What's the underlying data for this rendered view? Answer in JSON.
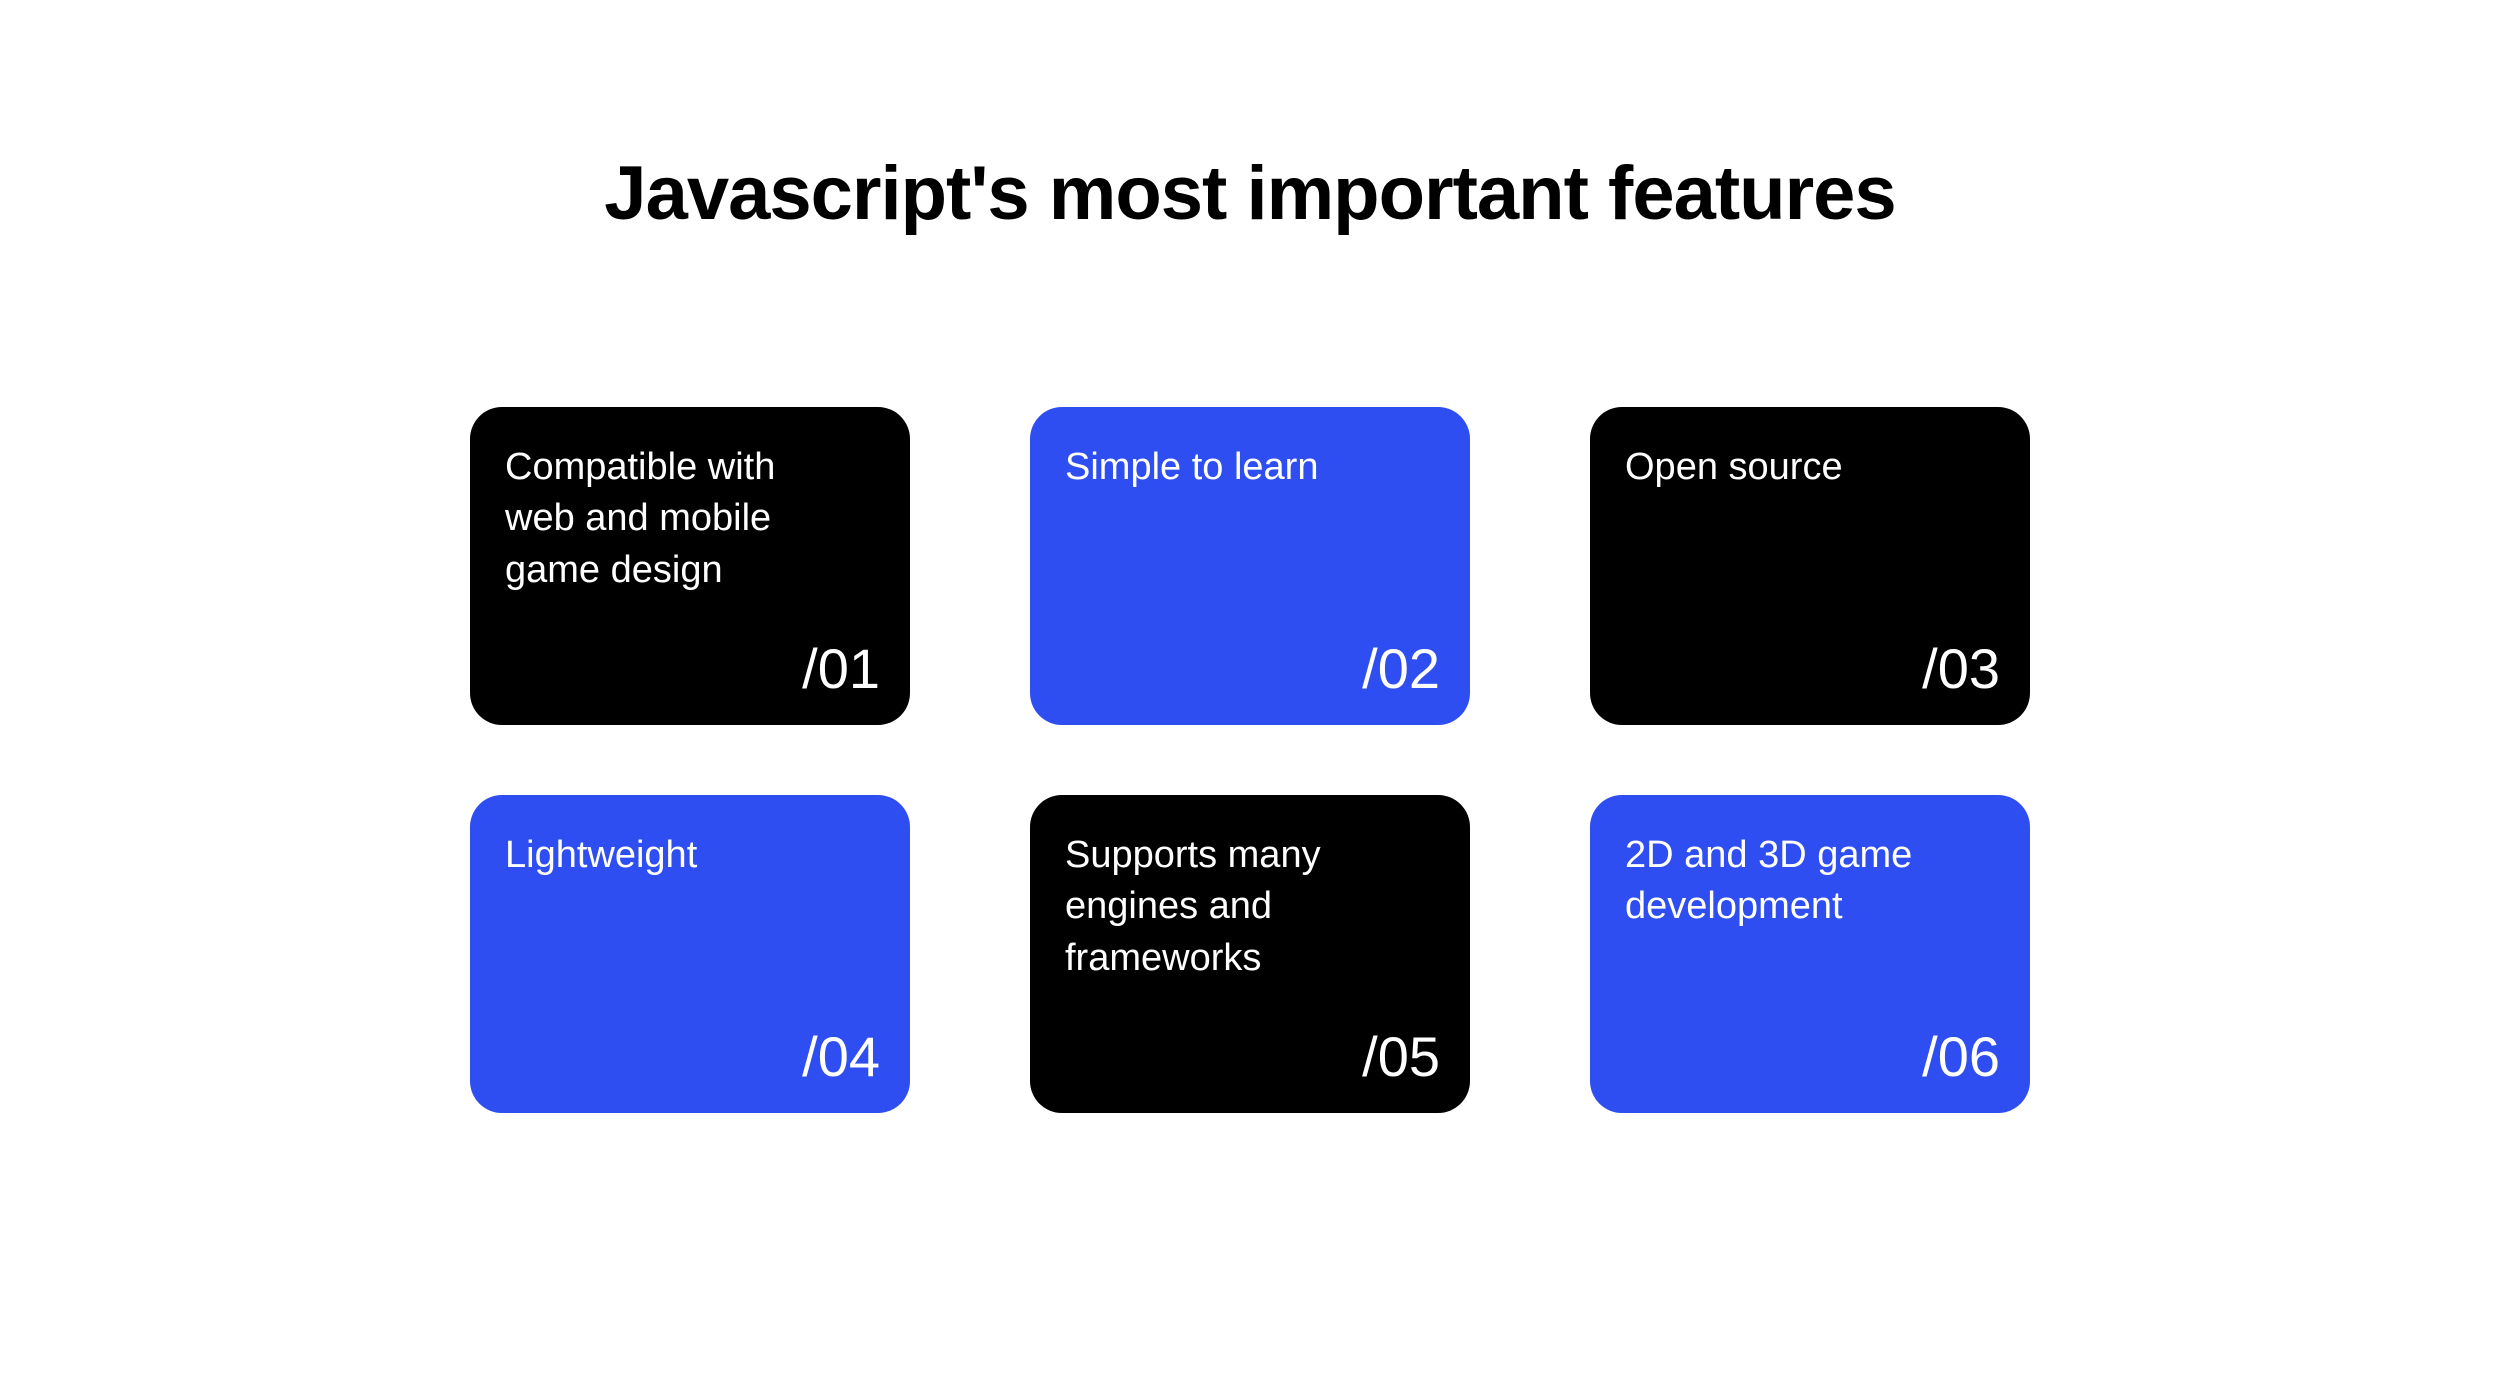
{
  "title": "Javascript's most important features",
  "cards": [
    {
      "text": "Compatible with web and mobile game design",
      "number": "/01",
      "color": "black"
    },
    {
      "text": "Simple to learn",
      "number": "/02",
      "color": "blue"
    },
    {
      "text": "Open source",
      "number": "/03",
      "color": "black"
    },
    {
      "text": "Lightweight",
      "number": "/04",
      "color": "blue"
    },
    {
      "text": "Supports many engines and frameworks",
      "number": "/05",
      "color": "black"
    },
    {
      "text": "2D and 3D game development",
      "number": "/06",
      "color": "blue"
    }
  ]
}
